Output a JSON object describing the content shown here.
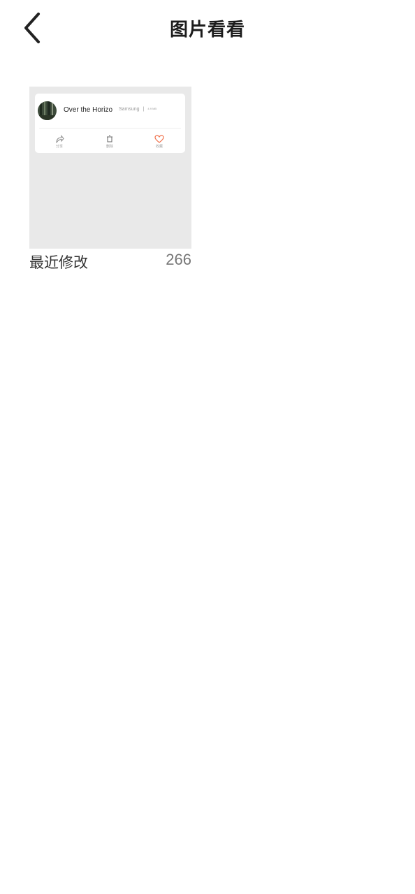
{
  "header": {
    "title": "图片看看",
    "back_icon": "chevron-left-icon"
  },
  "albums": [
    {
      "name": "最近修改",
      "count": "266",
      "thumbnail": {
        "title": "Over the Horizo",
        "artist": "Samsung",
        "separator": "|",
        "size": "4.9 MB",
        "actions": [
          {
            "label": "分享",
            "icon": "share-icon"
          },
          {
            "label": "删除",
            "icon": "trash-icon"
          },
          {
            "label": "收藏",
            "icon": "heart-icon"
          }
        ]
      }
    }
  ],
  "colors": {
    "background": "#ffffff",
    "thumb_background": "#e9e9e9",
    "heart_accent": "#f0704a"
  }
}
